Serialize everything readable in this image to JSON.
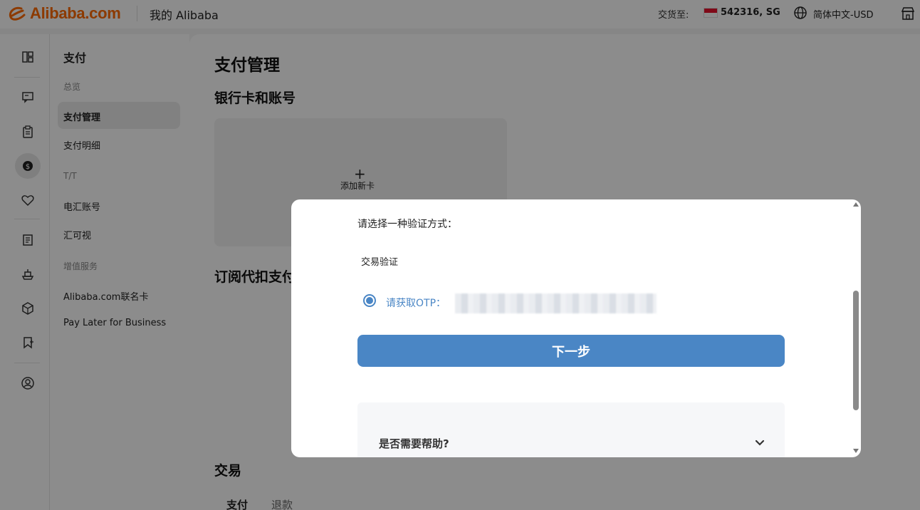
{
  "header": {
    "brand": "Alibaba.com",
    "title": "我的 Alibaba",
    "ship_to_label": "交货至:",
    "ship_to_value": "542316, SG",
    "language": "简体中文-USD"
  },
  "rail": {
    "icons": [
      "layout-icon",
      "ai-chat-icon",
      "clipboard-icon",
      "dollar-icon",
      "heart-icon",
      "document-icon",
      "ship-icon",
      "package-icon",
      "bookmark-add-icon",
      "user-circle-icon"
    ]
  },
  "subnav": {
    "title": "支付",
    "group_overview": "总览",
    "item_payment_mgmt": "支付管理",
    "item_payment_details": "支付明细",
    "group_tt": "T/T",
    "item_wire_account": "电汇账号",
    "item_huikeshi": "汇可视",
    "group_value_added": "增值服务",
    "item_cobrand": "Alibaba.com联名卡",
    "item_paylater": "Pay Later for Business"
  },
  "main": {
    "page_title": "支付管理",
    "section_bank": "银行卡和账号",
    "add_plus": "+",
    "add_card": "添加新卡",
    "section_subscription": "订阅代扣支付",
    "section_transactions": "交易",
    "tab_pay": "支付",
    "tab_refund": "退款"
  },
  "modal": {
    "prompt": "请选择一种验证方式：",
    "subtitle": "交易验证",
    "otp_label": "请获取OTP：",
    "next_button": "下一步",
    "help": "是否需要帮助?"
  },
  "colors": {
    "accent": "#4a86c5",
    "brand": "#ff6a00"
  }
}
